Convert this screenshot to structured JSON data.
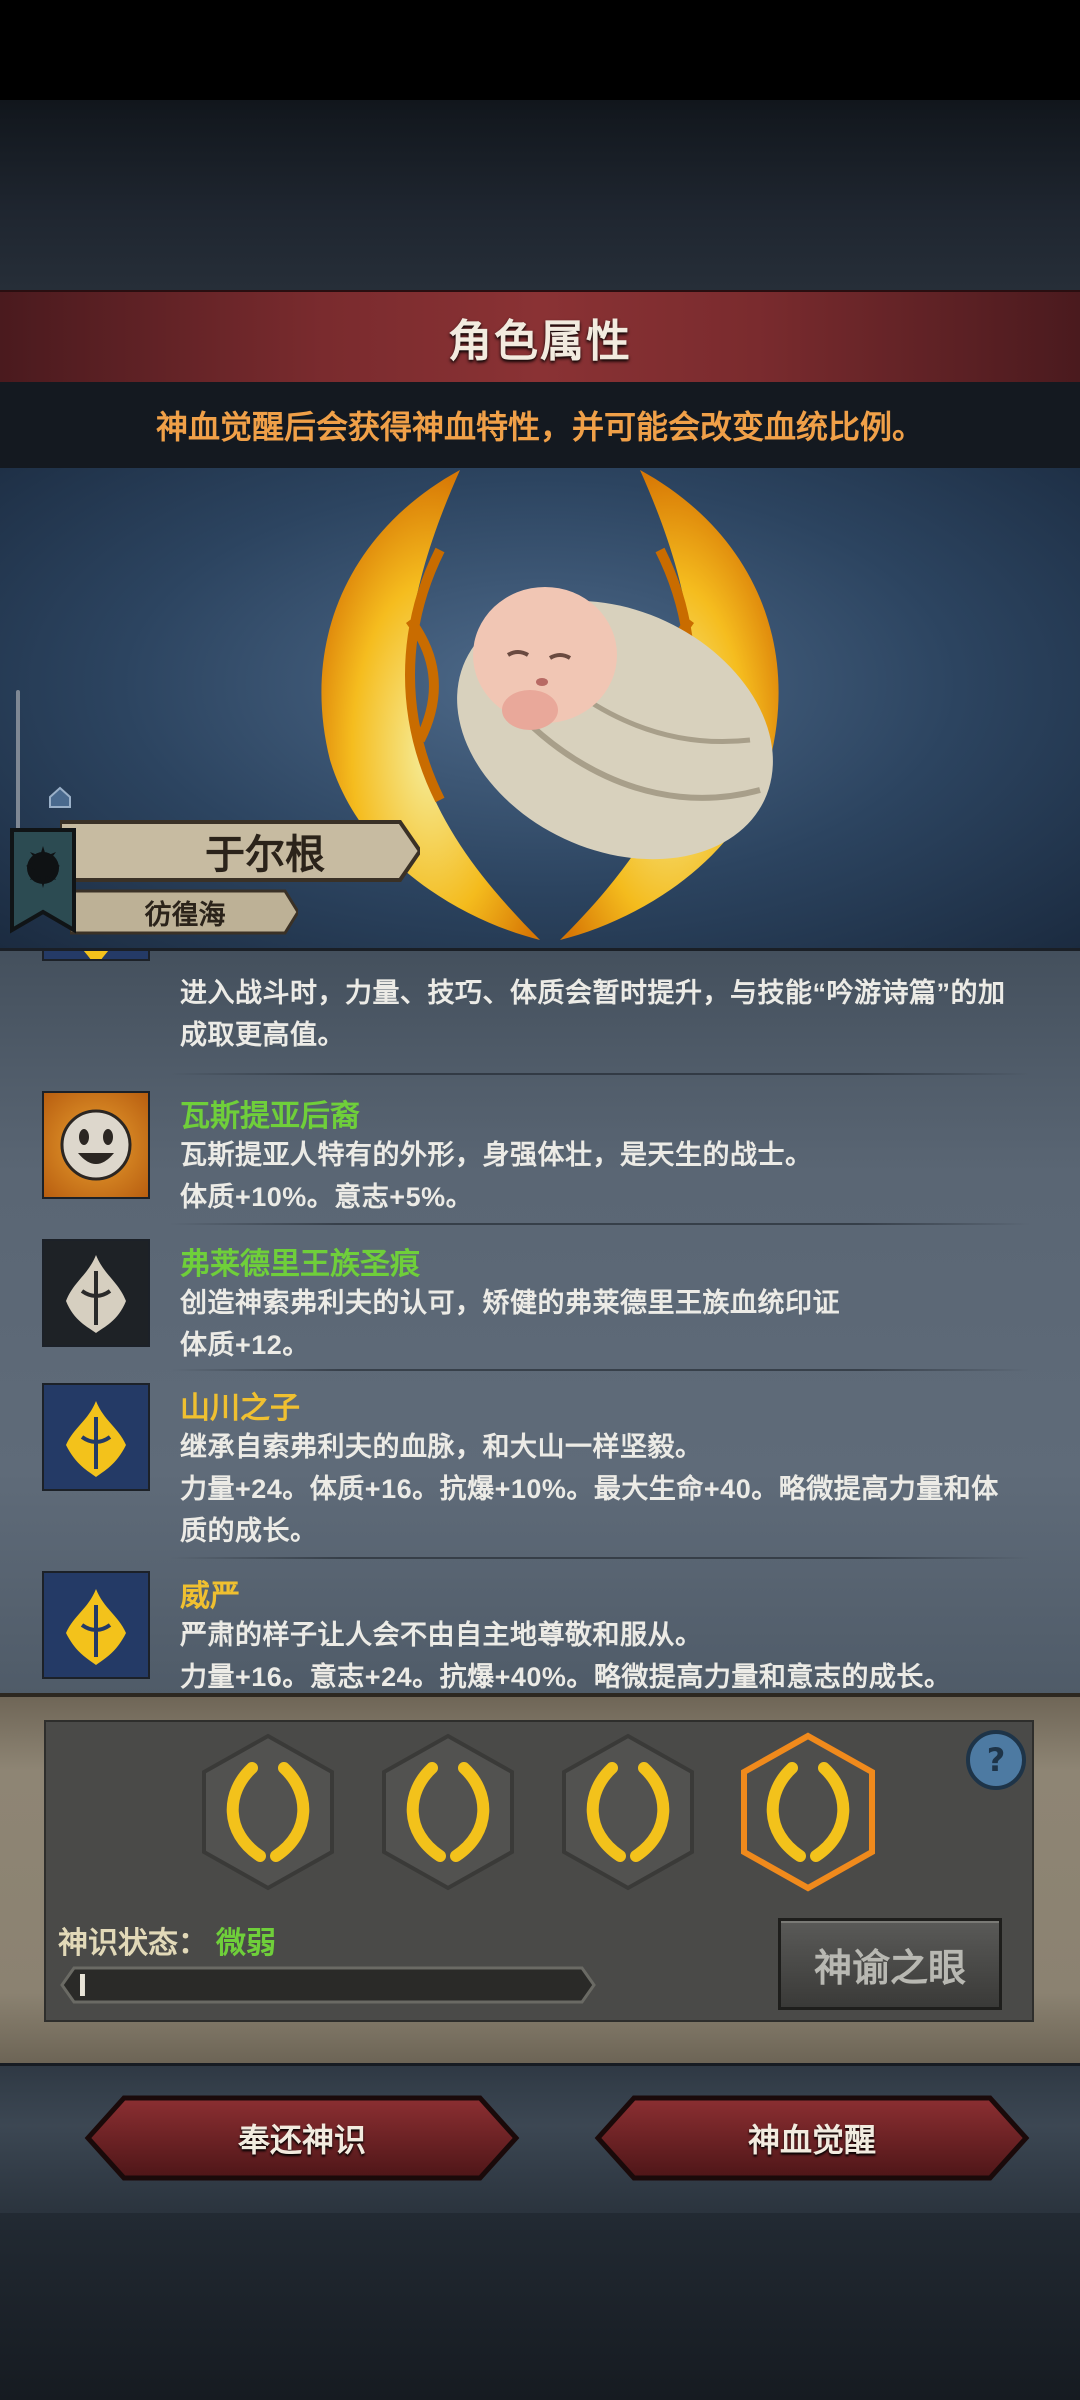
{
  "header": {
    "title": "角色属性",
    "subtitle": "神血觉醒后会获得神血特性，并可能会改变血统比例。"
  },
  "character": {
    "name": "于尔根",
    "title": "彷徨海"
  },
  "traits": [
    {
      "name": "",
      "lines": [
        "进入战斗时，力量、技巧、体质会暂时提升，与技能“吟游诗篇”的加",
        "成取更高值。"
      ],
      "icon": "golden-wreath-icon"
    },
    {
      "name": "瓦斯提亚后裔",
      "lines": [
        "瓦斯提亚人特有的外形，身强体壮，是天生的战士。",
        "体质+10%。意志+5%。"
      ],
      "icon": "smiling-face-icon"
    },
    {
      "name": "弗莱德里王族圣痕",
      "lines": [
        "创造神索弗利夫的认可，矫健的弗莱德里王族血统印证",
        "体质+12。"
      ],
      "icon": "white-crest-icon"
    },
    {
      "name": "山川之子",
      "lines": [
        "继承自索弗利夫的血脉，和大山一样坚毅。",
        "力量+24。体质+16。抗爆+10%。最大生命+40。略微提高力量和体",
        "质的成长。"
      ],
      "icon": "golden-crest-icon"
    },
    {
      "name": "威严",
      "lines": [
        "严肃的样子让人会不由自主地尊敬和服从。",
        "力量+16。意志+24。抗爆+40%。略微提高力量和意志的成长。"
      ],
      "icon": "golden-crest-icon"
    }
  ],
  "divine_sense": {
    "label": "神识状态：",
    "value": "微弱",
    "progress": 0.01,
    "oracle_button": "神谕之眼",
    "slots": 4,
    "selected_slot": 4
  },
  "actions": {
    "return_button": "奉还神识",
    "awaken_button": "神血觉醒"
  },
  "colors": {
    "trait_gold": "#f0c030",
    "trait_green": "#6fcf3a",
    "subtitle_orange": "#f0a048",
    "title_bar_red": "#7a2b2e"
  }
}
